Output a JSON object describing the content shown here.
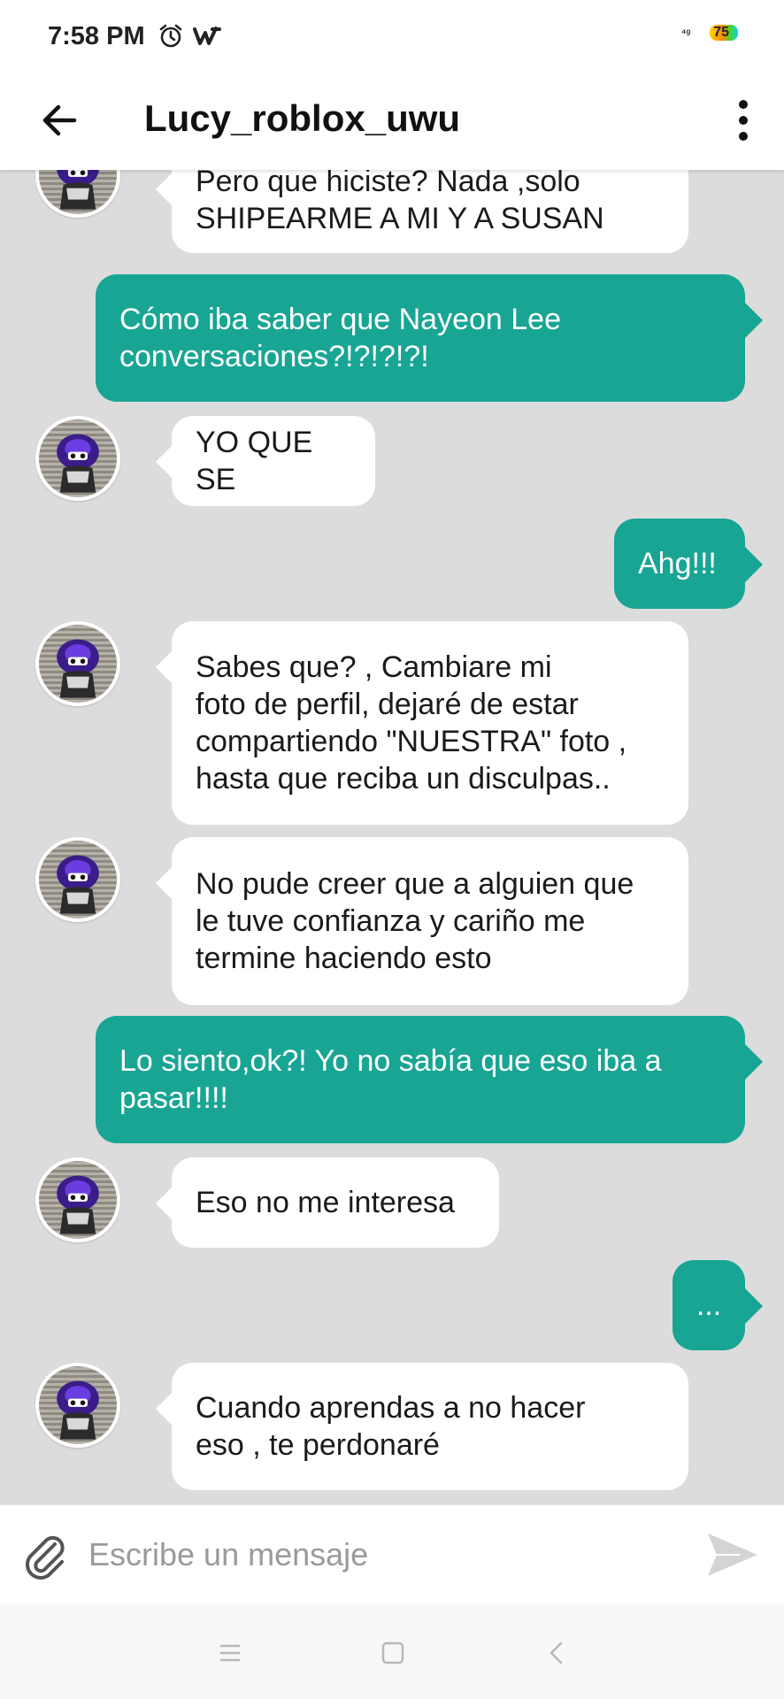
{
  "status_bar": {
    "time": "7:58 PM",
    "battery": "75",
    "icons": [
      "alarm-clock-icon",
      "wattpad-icon",
      "signal-icon",
      "battery-icon"
    ]
  },
  "header": {
    "title": "Lucy_roblox_uwu",
    "back_icon": "arrow-left-icon",
    "menu_icon": "more-vertical-icon"
  },
  "colors": {
    "outgoing_bubble": "#18a594",
    "incoming_bubble": "#ffffff",
    "chat_background": "#dcdcdc"
  },
  "messages": [
    {
      "from": "them",
      "text": "Pero que hiciste? Nada ,solo\nSHIPEARME A MI Y A SUSAN"
    },
    {
      "from": "me",
      "text": "Cómo iba saber que Nayeon Lee\nconversaciones?!?!?!?!"
    },
    {
      "from": "them",
      "text": "YO QUE SE"
    },
    {
      "from": "me",
      "text": "Ahg!!!"
    },
    {
      "from": "them",
      "text": "Sabes que? , Cambiare mi\nfoto de perfil, dejaré de estar\ncompartiendo \"NUESTRA\" foto ,\nhasta que reciba un disculpas.."
    },
    {
      "from": "them",
      "text": "No pude creer que a alguien que\nle tuve confianza y cariño me\ntermine haciendo esto"
    },
    {
      "from": "me",
      "text": "Lo siento,ok?! Yo no sabía que eso iba a\npasar!!!!"
    },
    {
      "from": "them",
      "text": "Eso no me interesa"
    },
    {
      "from": "me",
      "text": "..."
    },
    {
      "from": "them",
      "text": "Cuando aprendas a no hacer\neso , te perdonaré"
    }
  ],
  "composer": {
    "placeholder": "Escribe un mensaje",
    "attach_icon": "paperclip-icon",
    "send_icon": "send-icon"
  },
  "nav_bar": {
    "icons": [
      "menu-icon",
      "home-square-icon",
      "back-chevron-icon"
    ]
  }
}
